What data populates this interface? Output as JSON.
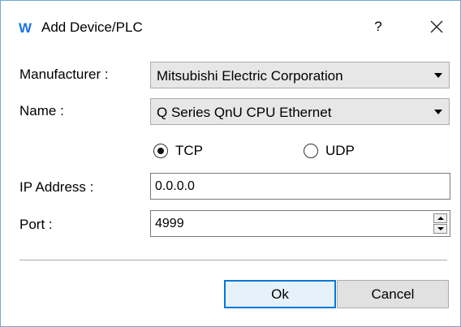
{
  "window": {
    "app_icon_text": "W",
    "title": "Add Device/PLC",
    "help_label": "?",
    "accent_color": "#1a73e8"
  },
  "form": {
    "manufacturer_label": "Manufacturer :",
    "manufacturer_value": "Mitsubishi Electric Corporation",
    "name_label": "Name :",
    "name_value": "Q Series QnU CPU Ethernet",
    "protocol": {
      "tcp_label": "TCP",
      "udp_label": "UDP",
      "selected": "TCP"
    },
    "ip_label": "IP Address :",
    "ip_value": "0.0.0.0",
    "port_label": "Port :",
    "port_value": "4999"
  },
  "buttons": {
    "ok_label": "Ok",
    "cancel_label": "Cancel"
  }
}
